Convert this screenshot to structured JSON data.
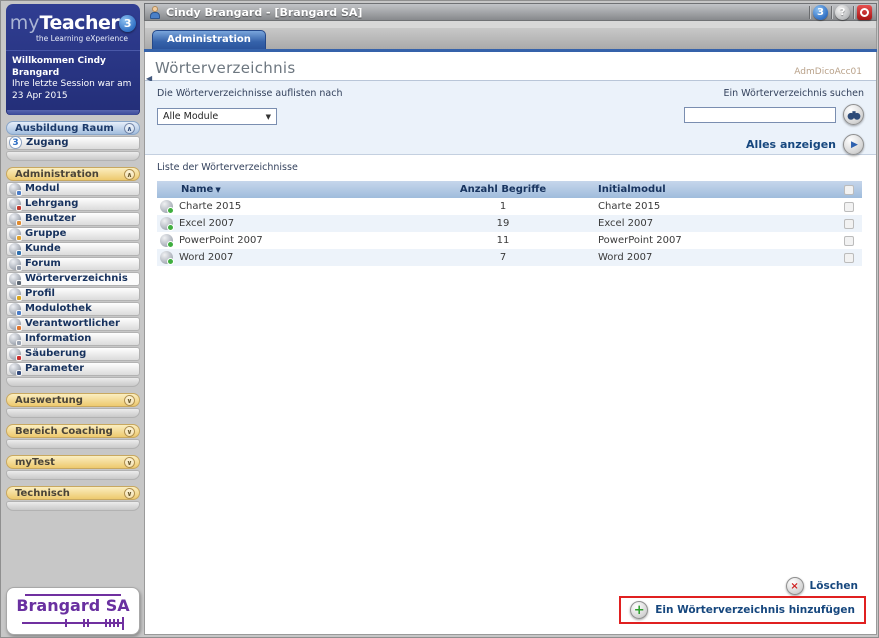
{
  "window": {
    "title": "Cindy Brangard - [Brangard SA]",
    "icons": {
      "app_badge": "3",
      "help_badge": "?"
    }
  },
  "brand": {
    "my": "my",
    "teacher": "Teacher",
    "three": "3",
    "tagline": "the Learning eXperience"
  },
  "welcome": {
    "line1": "Willkommen Cindy Brangard",
    "line2": "Ihre letzte Session war am 23 Apr 2015"
  },
  "sidebar": {
    "sections": [
      {
        "label": "Ausbildung Raum",
        "theme": "blue",
        "state": "expanded",
        "items": [
          {
            "label": "Zugang",
            "icon": "badge-3",
            "badge": "3"
          }
        ]
      },
      {
        "label": "Administration",
        "theme": "yellow",
        "state": "expanded",
        "items": [
          {
            "label": "Modul",
            "icon": "gear-module",
            "accent": "#4a7cc8"
          },
          {
            "label": "Lehrgang",
            "icon": "gear-course",
            "accent": "#c2392e"
          },
          {
            "label": "Benutzer",
            "icon": "gear-user",
            "accent": "#e08a2e"
          },
          {
            "label": "Gruppe",
            "icon": "gear-group",
            "accent": "#e0a22e"
          },
          {
            "label": "Kunde",
            "icon": "gear-customer",
            "accent": "#2e6fae"
          },
          {
            "label": "Forum",
            "icon": "gear-forum",
            "accent": "#8b95a5"
          },
          {
            "label": "Wörterverzeichnis",
            "icon": "gear-dictionary",
            "accent": "#5a6572",
            "selected": true
          },
          {
            "label": "Profil",
            "icon": "gear-key",
            "accent": "#d9a620"
          },
          {
            "label": "Modulothek",
            "icon": "gear-library",
            "accent": "#4a7cc8"
          },
          {
            "label": "Verantwortlicher",
            "icon": "gear-responsible",
            "accent": "#e0762e"
          },
          {
            "label": "Information",
            "icon": "gear-info",
            "accent": "#97a1b1"
          },
          {
            "label": "Säuberung",
            "icon": "gear-cleanup",
            "accent": "#cc2e2e"
          },
          {
            "label": "Parameter",
            "icon": "gear-parameter",
            "accent": "#31497c"
          }
        ]
      },
      {
        "label": "Auswertung",
        "theme": "yellow",
        "state": "collapsed",
        "items": []
      },
      {
        "label": "Bereich Coaching",
        "theme": "yellow",
        "state": "collapsed",
        "items": []
      },
      {
        "label": "myTest",
        "theme": "yellow",
        "state": "collapsed",
        "items": []
      },
      {
        "label": "Technisch",
        "theme": "yellow",
        "state": "collapsed",
        "items": []
      }
    ],
    "footer_logo": "Brangard SA"
  },
  "main": {
    "tab": "Administration",
    "page_title": "Wörterverzeichnis",
    "page_code": "AdmDicoAcc01",
    "filter": {
      "list_by_label": "Die Wörterverzeichnisse auflisten nach",
      "module_select_value": "Alle Module",
      "search_label": "Ein Wörterverzeichnis suchen",
      "search_value": "",
      "show_all_label": "Alles anzeigen"
    },
    "list_label": "Liste der Wörterverzeichnisse",
    "table": {
      "columns": {
        "name": "Name",
        "count": "Anzahl Begriffe",
        "module": "Initialmodul"
      },
      "sort": {
        "column": "Name",
        "direction": "desc"
      },
      "rows": [
        {
          "name": "Charte 2015",
          "count": "1",
          "module": "Charte 2015"
        },
        {
          "name": "Excel 2007",
          "count": "19",
          "module": "Excel 2007"
        },
        {
          "name": "PowerPoint 2007",
          "count": "11",
          "module": "PowerPoint 2007"
        },
        {
          "name": "Word 2007",
          "count": "7",
          "module": "Word 2007"
        }
      ]
    },
    "actions": {
      "delete_label": "Löschen",
      "add_label": "Ein Wörterverzeichnis hinzufügen"
    }
  },
  "glyphs": {
    "sort_desc": "▼",
    "play": "▶",
    "collapse_left": "◀",
    "chevron_up": "∧",
    "chevron_down": "∨",
    "delete_x": "×",
    "add_plus": "+",
    "select_arrow": "▼"
  },
  "colors": {
    "accent_blue": "#3562aa",
    "navy_text": "#16477e",
    "highlight_red": "#e02020",
    "panel_blue": "#ebf2fa",
    "header_gradient_top": "#c6d6eb",
    "brand_navy": "#232e78",
    "brand_purple": "#6930a0",
    "section_yellow": "#edc96e"
  }
}
